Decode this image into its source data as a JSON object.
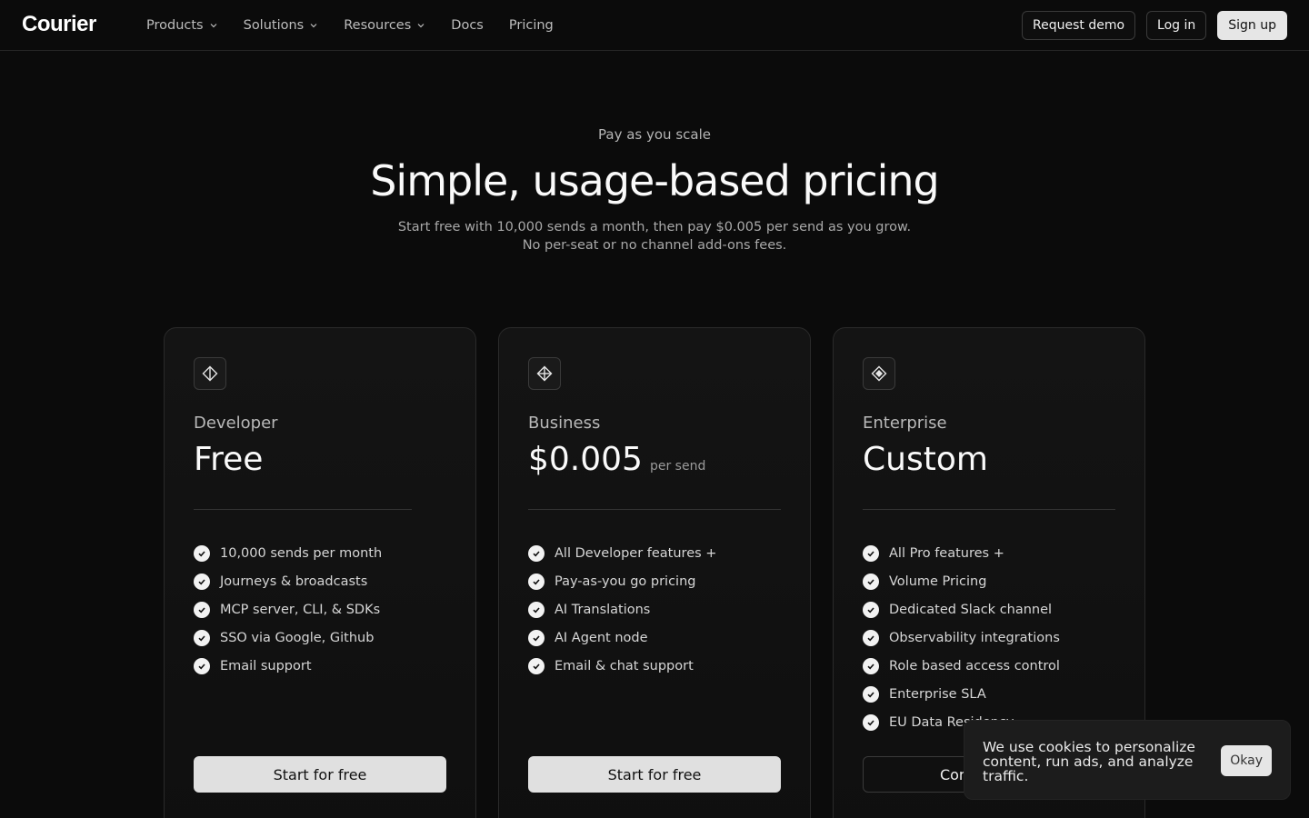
{
  "nav": {
    "logo": "Courier",
    "links": [
      "Products",
      "Solutions",
      "Resources",
      "Docs",
      "Pricing"
    ],
    "request_demo": "Request demo",
    "login": "Log in",
    "signup": "Sign up"
  },
  "hero": {
    "eyebrow": "Pay as you scale",
    "title": "Simple, usage-based pricing",
    "subtitle_line1": "Start free with 10,000 sends a month, then pay $0.005 per send as you grow.",
    "subtitle_line2": "No per-seat or no channel add-ons fees."
  },
  "plans": [
    {
      "name": "Developer",
      "price": "Free",
      "unit": "",
      "features": [
        "10,000 sends per month",
        "Journeys & broadcasts",
        "MCP server, CLI, & SDKs",
        "SSO via Google, Github",
        "Email support"
      ],
      "cta": "Start for free"
    },
    {
      "name": "Business",
      "price": "$0.005",
      "unit": "per send",
      "features": [
        "All Developer features +",
        "Pay-as-you go pricing",
        "AI Translations",
        "AI Agent node",
        "Email & chat support"
      ],
      "cta": "Start for free"
    },
    {
      "name": "Enterprise",
      "price": "Custom",
      "unit": "",
      "features": [
        "All Pro features +",
        "Volume Pricing",
        "Dedicated Slack channel",
        "Observability integrations",
        "Role based access control",
        "Enterprise SLA",
        "EU Data Residency"
      ],
      "cta": "Contact sales"
    }
  ],
  "cookie": {
    "message": "We use cookies to personalize content, run ads, and analyze traffic.",
    "button": "Okay"
  }
}
